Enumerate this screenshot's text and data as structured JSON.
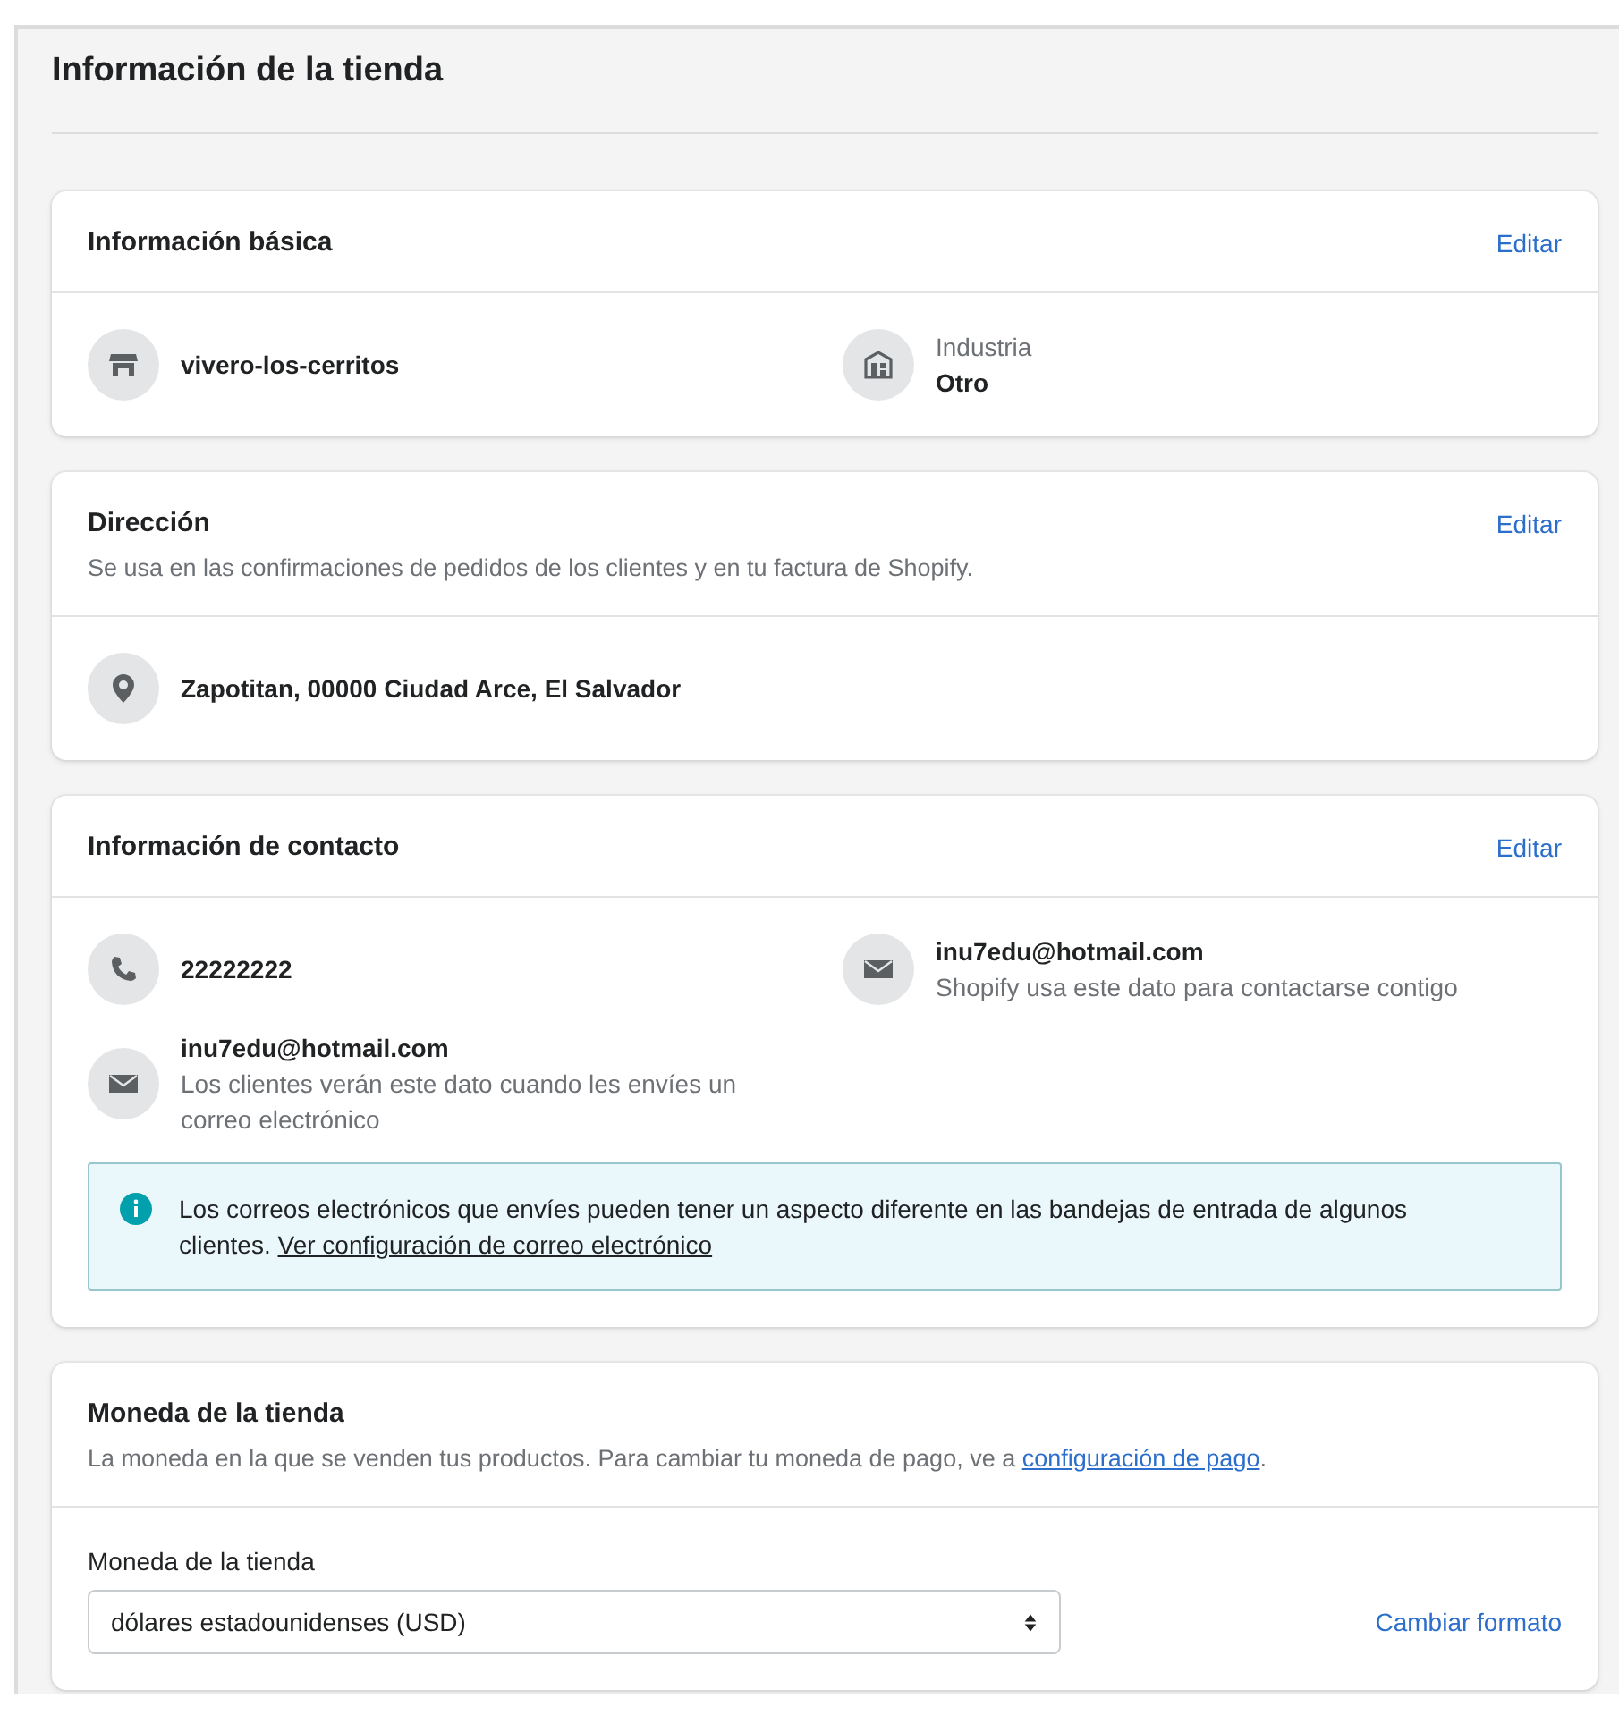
{
  "page": {
    "title": "Información de la tienda"
  },
  "sections": [
    {
      "kind": "items",
      "title": "Información básica",
      "edit": "Editar",
      "items": [
        {
          "kind": "store",
          "value": "vivero-los-cerritos"
        },
        {
          "kind": "building",
          "label": "Industria",
          "value": "Otro"
        }
      ]
    },
    {
      "kind": "items",
      "title": "Dirección",
      "edit": "Editar",
      "description": "Se usa en las confirmaciones de pedidos de los clientes y en tu factura de Shopify.",
      "items": [
        {
          "kind": "pin",
          "value": "Zapotitan, 00000 Ciudad Arce, El Salvador"
        }
      ]
    },
    {
      "kind": "items",
      "title": "Información de contacto",
      "edit": "Editar",
      "items": [
        {
          "kind": "phone",
          "value": "22222222"
        },
        {
          "kind": "mail",
          "value": "inu7edu@hotmail.com",
          "note": "Shopify usa este dato para contactarse contigo"
        },
        {
          "kind": "mail",
          "value": "inu7edu@hotmail.com",
          "note": "Los clientes verán este dato cuando les envíes un correo electrónico"
        }
      ],
      "notice": {
        "text": "Los correos electrónicos que envíes pueden tener un aspecto diferente en las bandejas de entrada de algunos clientes. ",
        "link": "Ver configuración de correo electrónico"
      }
    },
    {
      "kind": "currency",
      "title": "Moneda de la tienda",
      "description": "La moneda en la que se venden tus productos. Para cambiar tu moneda de pago, ve a ",
      "description_link": "configuración de pago",
      "description_end": ".",
      "field": {
        "label": "Moneda de la tienda",
        "value": "dólares estadounidenses (USD)",
        "action": "Cambiar formato"
      }
    }
  ]
}
